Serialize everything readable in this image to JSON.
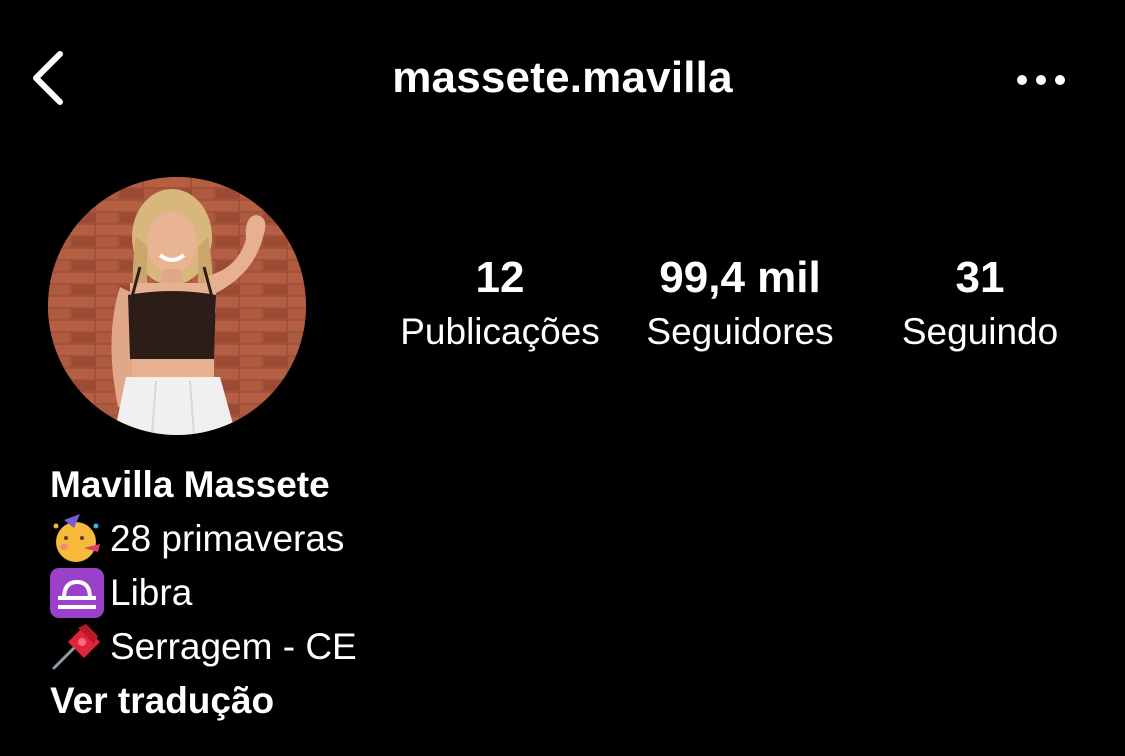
{
  "header": {
    "username": "massete.mavilla",
    "back_icon": "chevron-left-icon",
    "more_icon": "more-horizontal-icon"
  },
  "stats": {
    "posts": {
      "value": "12",
      "label": "Publicações"
    },
    "followers": {
      "value": "99,4 mil",
      "label": "Seguidores"
    },
    "following": {
      "value": "31",
      "label": "Seguindo"
    }
  },
  "bio": {
    "full_name": "Mavilla Massete",
    "lines": [
      {
        "icon": "party-face-emoji",
        "text": "28 primaveras"
      },
      {
        "icon": "libra-sign-emoji",
        "text": " Libra"
      },
      {
        "icon": "pushpin-emoji",
        "text": "Serragem - CE"
      }
    ],
    "translate_link": "Ver tradução"
  },
  "colors": {
    "background": "#000000",
    "text": "#ffffff",
    "libra_purple": "#9b40c8"
  }
}
